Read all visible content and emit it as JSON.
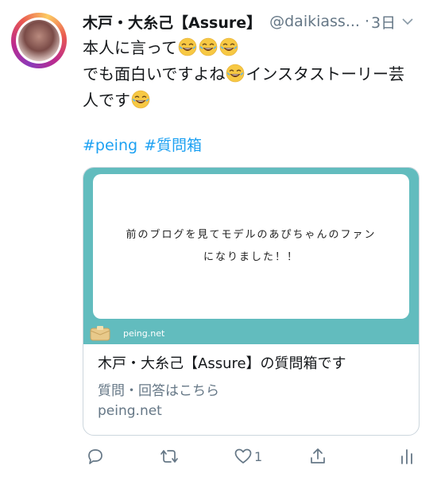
{
  "tweet": {
    "display_name": "木戸・大糸己【Assure】",
    "handle": "@daikiass...",
    "separator": "·",
    "time": "3日",
    "lines": [
      "本人に言って",
      "でも面白いですよね",
      "インスタストーリー芸",
      "人です"
    ],
    "hashtags": [
      "#peing",
      "#質問箱"
    ]
  },
  "card": {
    "question_line1": "前のブログを見てモデルのあぴちゃんのファン",
    "question_line2": "になりました！！",
    "site_label": "peing.net",
    "title": "木戸・大糸己【Assure】の質問箱です",
    "description": "質問・回答はこちら",
    "url": "peing.net",
    "accent_color": "#62bcbe"
  },
  "actions": {
    "reply_icon": "reply-icon",
    "retweet_icon": "retweet-icon",
    "like_icon": "heart-icon",
    "like_count": "1",
    "share_icon": "share-icon",
    "analytics_icon": "analytics-icon"
  },
  "colors": {
    "link": "#1da1f2",
    "secondary": "#657786",
    "text": "#14171a"
  }
}
